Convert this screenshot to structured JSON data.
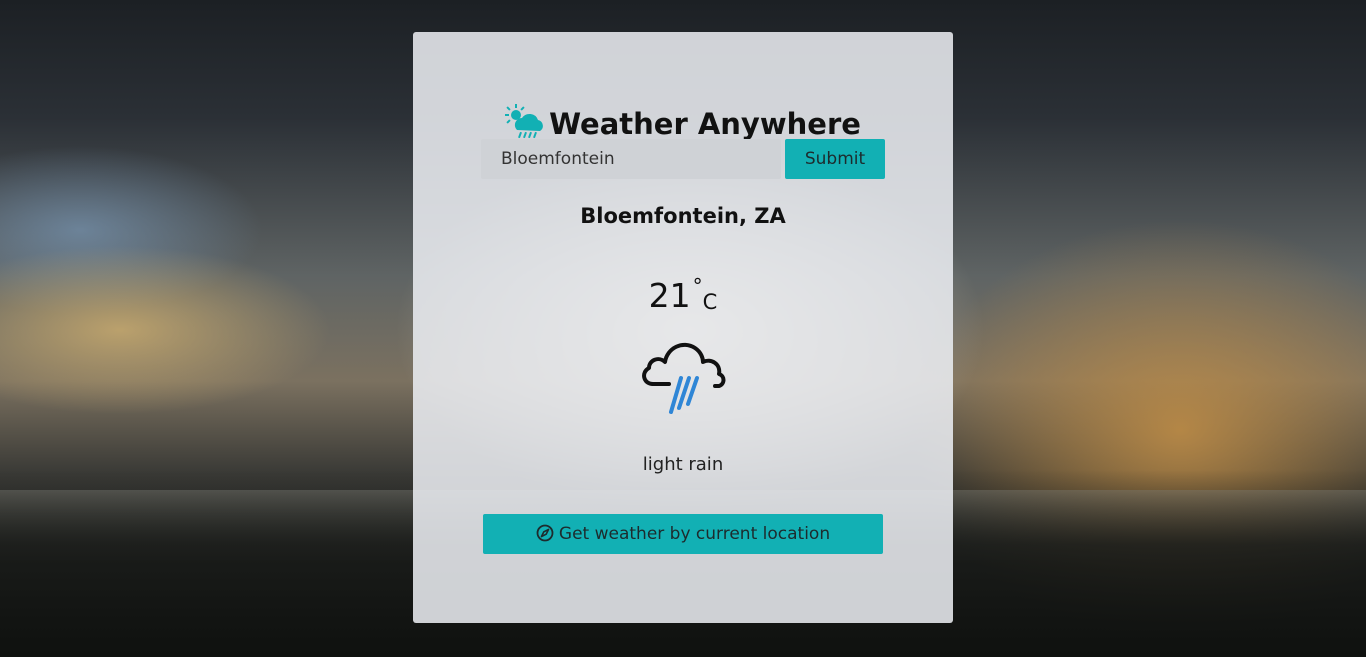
{
  "app": {
    "title": "Weather Anywhere",
    "logo_icon": "cloud-sun-rain-icon"
  },
  "search": {
    "value": "Bloemfontein",
    "placeholder": "",
    "submit_label": "Submit"
  },
  "weather": {
    "location": "Bloemfontein, ZA",
    "temperature": "21",
    "degree_symbol": "°",
    "unit": "C",
    "icon": "cloud-rain-icon",
    "description": "light rain"
  },
  "geolocation": {
    "button_label": "Get weather by current location",
    "icon": "compass-icon"
  },
  "colors": {
    "accent": "#12b0b4",
    "rain": "#2f86d6",
    "card_background": "#e9ecf0"
  }
}
